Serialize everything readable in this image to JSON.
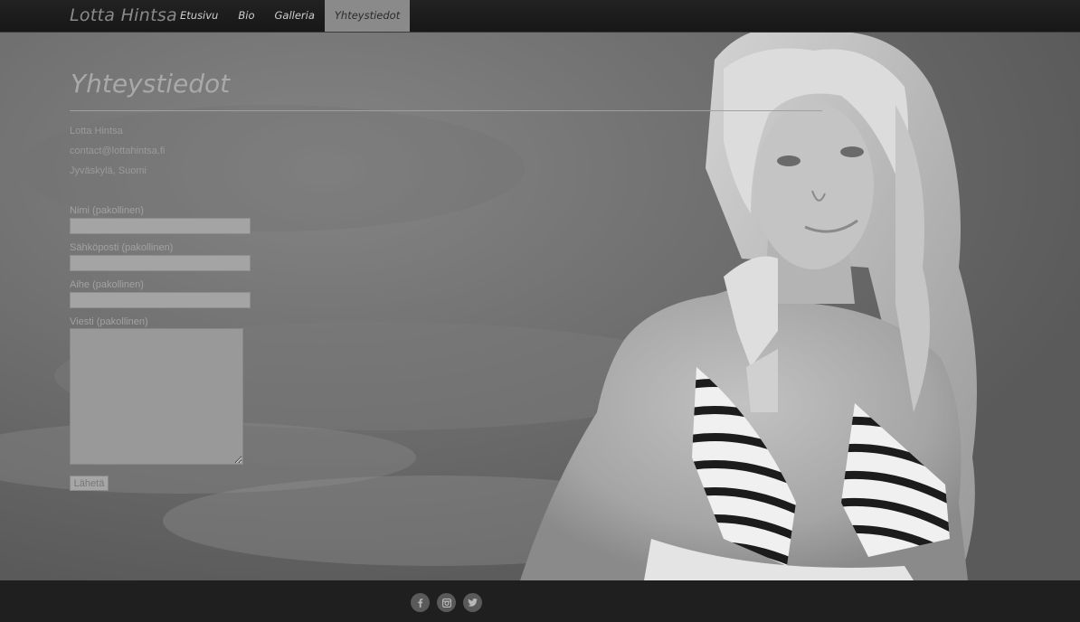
{
  "nav": {
    "brand": "Lotta Hintsa",
    "items": [
      {
        "label": "Etusivu",
        "active": false
      },
      {
        "label": "Bio",
        "active": false
      },
      {
        "label": "Galleria",
        "active": false
      },
      {
        "label": "Yhteystiedot",
        "active": true
      }
    ]
  },
  "page": {
    "title": "Yhteystiedot"
  },
  "contact": {
    "name": "Lotta Hintsa",
    "email": "contact@lottahintsa.fi",
    "location": "Jyväskylä, Suomi"
  },
  "form": {
    "name_label": "Nimi (pakollinen)",
    "name_value": "",
    "email_label": "Sähköposti (pakollinen)",
    "email_value": "",
    "subject_label": "Aihe (pakollinen)",
    "subject_value": "",
    "message_label": "Viesti (pakollinen)",
    "message_value": "",
    "submit_label": "Lähetä"
  },
  "footer": {
    "social": [
      {
        "icon": "facebook-icon"
      },
      {
        "icon": "instagram-icon"
      },
      {
        "icon": "twitter-icon"
      }
    ]
  },
  "colors": {
    "nav_background": "#1b1b1b",
    "active_tab": "#8a8a8a",
    "footer_background": "#1f1f1f"
  }
}
